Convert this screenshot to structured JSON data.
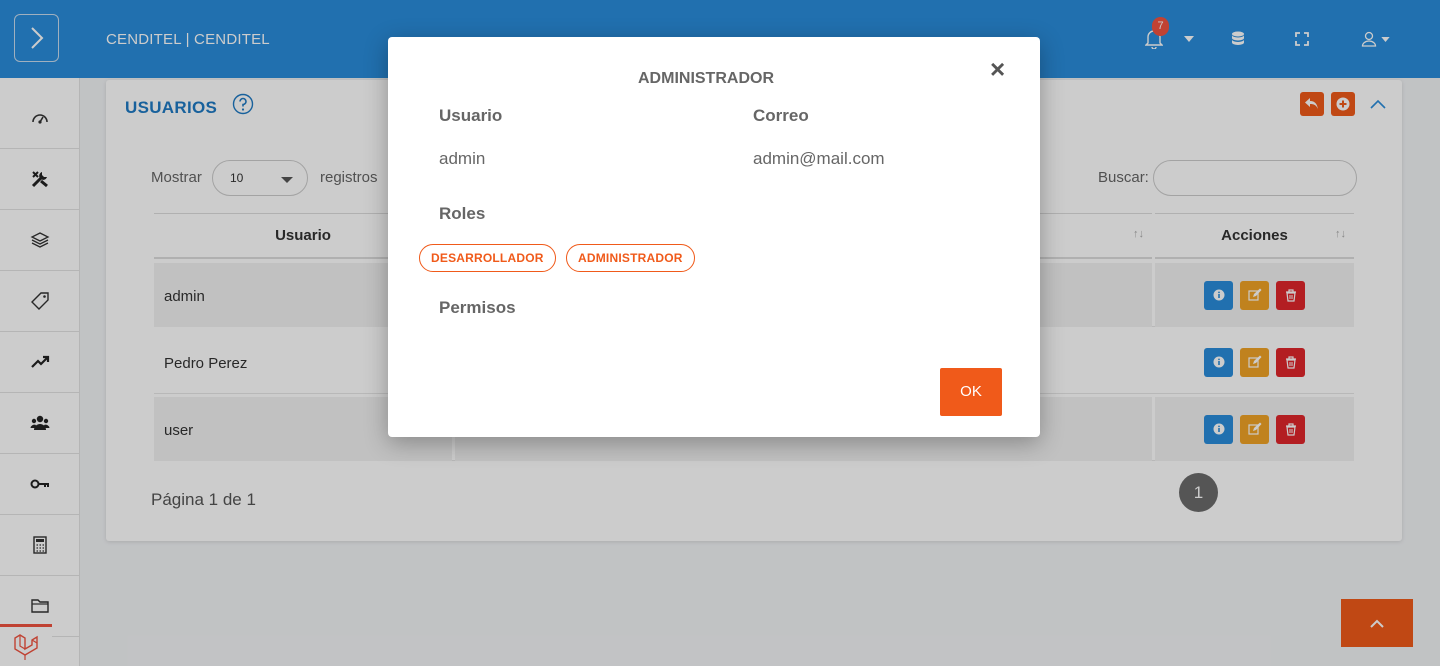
{
  "header": {
    "brand": "CENDITEL | CENDITEL",
    "notification_count": "7",
    "icons": [
      "bell-icon",
      "caret-down-icon",
      "database-icon",
      "fullscreen-icon",
      "user-icon"
    ]
  },
  "sidebar": {
    "items": [
      "dashboard-icon",
      "tools-icon",
      "layers-icon",
      "tag-icon",
      "trend-icon",
      "users-icon",
      "key-icon",
      "calculator-icon",
      "folder-icon"
    ]
  },
  "card": {
    "title": "USUARIOS",
    "show_label": "Mostrar",
    "show_value": "10",
    "records_label": "registros",
    "search_label": "Buscar:",
    "columns": {
      "user": "Usuario",
      "actions": "Acciones"
    },
    "rows": [
      {
        "user": "admin"
      },
      {
        "user": "Pedro Perez"
      },
      {
        "user": "user"
      }
    ],
    "page_info": "Página 1 de 1",
    "current_page": "1"
  },
  "modal": {
    "title": "ADMINISTRADOR",
    "close": "×",
    "user_label": "Usuario",
    "user_value": "admin",
    "email_label": "Correo",
    "email_value": "admin@mail.com",
    "roles_label": "Roles",
    "roles": [
      "DESARROLLADOR",
      "ADMINISTRADOR"
    ],
    "permissions_label": "Permisos",
    "ok_label": "OK"
  },
  "colors": {
    "primary": "#2a8ddb",
    "accent": "#f05a1a",
    "warning": "#f0a326",
    "danger": "#e0262b",
    "title": "#1f7ac4"
  }
}
